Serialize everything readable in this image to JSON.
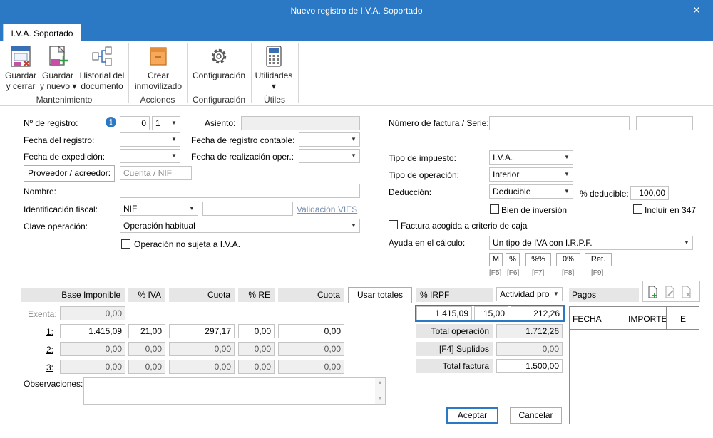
{
  "window": {
    "title": "Nuevo registro de I.V.A. Soportado",
    "minimize": "—",
    "close": "✕"
  },
  "tab": {
    "label": "I.V.A. Soportado"
  },
  "ribbon": {
    "guardar_cerrar": "Guardar\ny cerrar",
    "guardar_nuevo": "Guardar\ny nuevo ▾",
    "historial": "Historial del\ndocumento",
    "crear_inmovilizado": "Crear\ninmovilizado",
    "configuracion": "Configuración",
    "utilidades": "Utilidades\n▾",
    "groups": {
      "mantenimiento": "Mantenimiento",
      "acciones": "Acciones",
      "configuracion": "Configuración",
      "utiles": "Útiles"
    }
  },
  "form": {
    "n_registro_label": "Nº de registro:",
    "n_registro_a": "0",
    "n_registro_b": "1",
    "asiento_label": "Asiento:",
    "asiento_value": "",
    "fecha_registro_label": "Fecha del registro:",
    "fecha_registro_contable_label": "Fecha de registro contable:",
    "fecha_expedicion_label": "Fecha de expedición:",
    "fecha_realizacion_label": "Fecha de realización oper.:",
    "proveedor_button": "Proveedor / acreedor:",
    "cuenta_placeholder": "Cuenta / NIF",
    "nombre_label": "Nombre:",
    "nombre_value": "",
    "identificacion_label": "Identificación fiscal:",
    "identificacion_value": "NIF",
    "validacion_link": "Validación VIES",
    "clave_label": "Clave operación:",
    "clave_value": "Operación habitual",
    "no_sujeta_label": "Operación no sujeta a I.V.A.",
    "numero_factura_label": "Número de factura / Serie:",
    "tipo_impuesto_label": "Tipo de impuesto:",
    "tipo_impuesto_value": "I.V.A.",
    "tipo_operacion_label": "Tipo de operación:",
    "tipo_operacion_value": "Interior",
    "deduccion_label": "Deducción:",
    "deduccion_value": "Deducible",
    "pct_deducible_label": "% deducible:",
    "pct_deducible_value": "100,00",
    "bien_inversion_label": "Bien de inversión",
    "incluir_347_label": "Incluir en 347",
    "criterio_caja_label": "Factura acogida a criterio de caja",
    "ayuda_label": "Ayuda en el cálculo:",
    "ayuda_value": "Un tipo de IVA con I.R.P.F.",
    "calc_buttons": [
      {
        "label": "M",
        "key": "[F5]"
      },
      {
        "label": "%",
        "key": "[F6]"
      },
      {
        "label": "%%",
        "key": "[F7]"
      },
      {
        "label": "0%",
        "key": "[F8]"
      },
      {
        "label": "Ret.",
        "key": "[F9]"
      }
    ]
  },
  "grid": {
    "headers": {
      "base": "Base Imponible",
      "pct_iva": "% IVA",
      "cuota": "Cuota",
      "pct_re": "% RE",
      "cuota_re": "Cuota"
    },
    "usar_totales": "Usar totales",
    "exenta_label": "Exenta:",
    "exenta_value": "0,00",
    "rows": [
      {
        "label": "1:",
        "base": "1.415,09",
        "iva": "21,00",
        "cuota": "297,17",
        "re": "0,00",
        "cuota_re": "0,00"
      },
      {
        "label": "2:",
        "base": "0,00",
        "iva": "0,00",
        "cuota": "0,00",
        "re": "0,00",
        "cuota_re": "0,00"
      },
      {
        "label": "3:",
        "base": "0,00",
        "iva": "0,00",
        "cuota": "0,00",
        "re": "0,00",
        "cuota_re": "0,00"
      }
    ]
  },
  "irpf": {
    "header": "% IRPF",
    "actividad": "Actividad pro",
    "base": "1.415,09",
    "pct": "15,00",
    "cuota": "212,26",
    "total_operacion_label": "Total operación",
    "total_operacion": "1.712,26",
    "suplidos_label": "[F4] Suplidos",
    "suplidos": "0,00",
    "total_factura_label": "Total factura",
    "total_factura": "1.500,00"
  },
  "pagos": {
    "title": "Pagos",
    "col_fecha": "FECHA",
    "col_importe": "IMPORTE",
    "col_e": "E"
  },
  "observaciones_label": "Observaciones:",
  "aceptar": "Aceptar",
  "cancelar": "Cancelar"
}
